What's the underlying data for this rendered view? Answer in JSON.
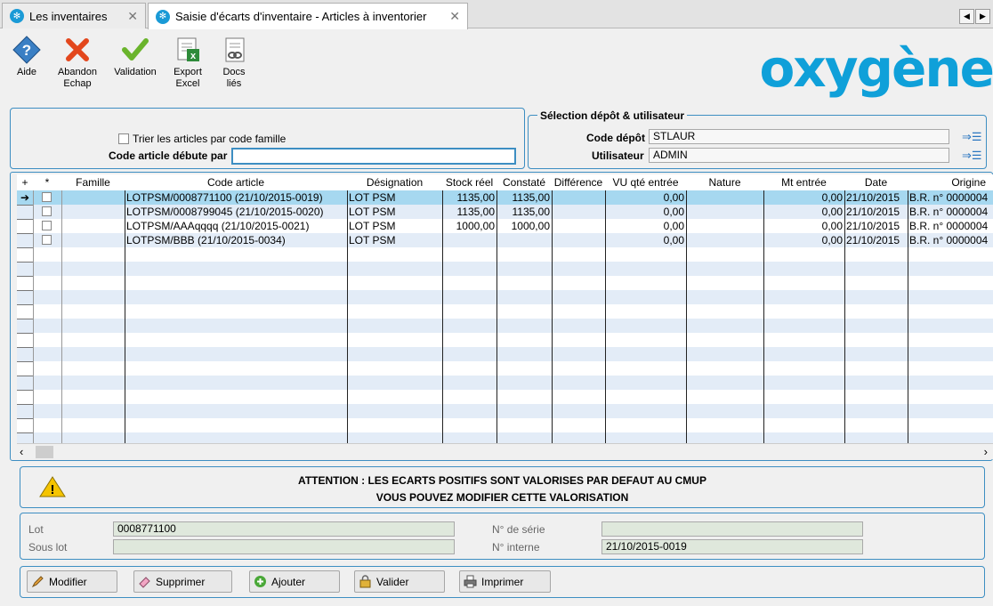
{
  "tabs": [
    {
      "label": "Les inventaires"
    },
    {
      "label": "Saisie d'écarts d'inventaire - Articles à inventorier"
    }
  ],
  "toolbar": {
    "aide": "Aide",
    "abandon": "Abandon\nEchap",
    "validation": "Validation",
    "export": "Export\nExcel",
    "docs": "Docs\nliés"
  },
  "logo": "oxygène",
  "filter": {
    "trier_label": "Trier les articles par code famille",
    "code_label": "Code article débute par",
    "code_value": ""
  },
  "depot": {
    "title": "Sélection dépôt & utilisateur",
    "code_label": "Code dépôt",
    "code_value": "STLAUR",
    "user_label": "Utilisateur",
    "user_value": "ADMIN"
  },
  "grid": {
    "headers": {
      "add": "+",
      "star": "*",
      "famille": "Famille",
      "code": "Code article",
      "designation": "Désignation",
      "stock": "Stock réel",
      "constate": "Constaté",
      "difference": "Différence",
      "vu": "VU qté entrée",
      "nature": "Nature",
      "mt": "Mt entrée",
      "date": "Date",
      "origine": "Origine"
    },
    "rows": [
      {
        "code": "LOTPSM/0008771100 (21/10/2015-0019)",
        "designation": "LOT PSM",
        "stock": "1135,00",
        "constate": "1135,00",
        "difference": "",
        "vu": "0,00",
        "nature": "",
        "mt": "0,00",
        "date": "21/10/2015",
        "origine": "B.R. n° 0000004"
      },
      {
        "code": "LOTPSM/0008799045 (21/10/2015-0020)",
        "designation": "LOT PSM",
        "stock": "1135,00",
        "constate": "1135,00",
        "difference": "",
        "vu": "0,00",
        "nature": "",
        "mt": "0,00",
        "date": "21/10/2015",
        "origine": "B.R. n° 0000004"
      },
      {
        "code": "LOTPSM/AAAqqqq (21/10/2015-0021)",
        "designation": "LOT PSM",
        "stock": "1000,00",
        "constate": "1000,00",
        "difference": "",
        "vu": "0,00",
        "nature": "",
        "mt": "0,00",
        "date": "21/10/2015",
        "origine": "B.R. n° 0000004"
      },
      {
        "code": "LOTPSM/BBB (21/10/2015-0034)",
        "designation": "LOT PSM",
        "stock": "",
        "constate": "",
        "difference": "",
        "vu": "0,00",
        "nature": "",
        "mt": "0,00",
        "date": "21/10/2015",
        "origine": "B.R. n° 0000004"
      }
    ]
  },
  "warning": {
    "line1": "ATTENTION : LES ECARTS POSITIFS SONT VALORISES PAR DEFAUT AU CMUP",
    "line2": "VOUS POUVEZ MODIFIER CETTE VALORISATION"
  },
  "lot": {
    "lot_label": "Lot",
    "lot_value": "0008771100",
    "souslot_label": "Sous lot",
    "souslot_value": "",
    "serie_label": "N° de série",
    "serie_value": "",
    "interne_label": "N° interne",
    "interne_value": "21/10/2015-0019"
  },
  "buttons": {
    "modifier": "Modifier",
    "supprimer": "Supprimer",
    "ajouter": "Ajouter",
    "valider": "Valider",
    "imprimer": "Imprimer"
  },
  "colors": {
    "accent": "#3d8ec2",
    "selected": "#a6d8f0",
    "alt": "#e3ecf7",
    "logo": "#0fa0d9"
  }
}
